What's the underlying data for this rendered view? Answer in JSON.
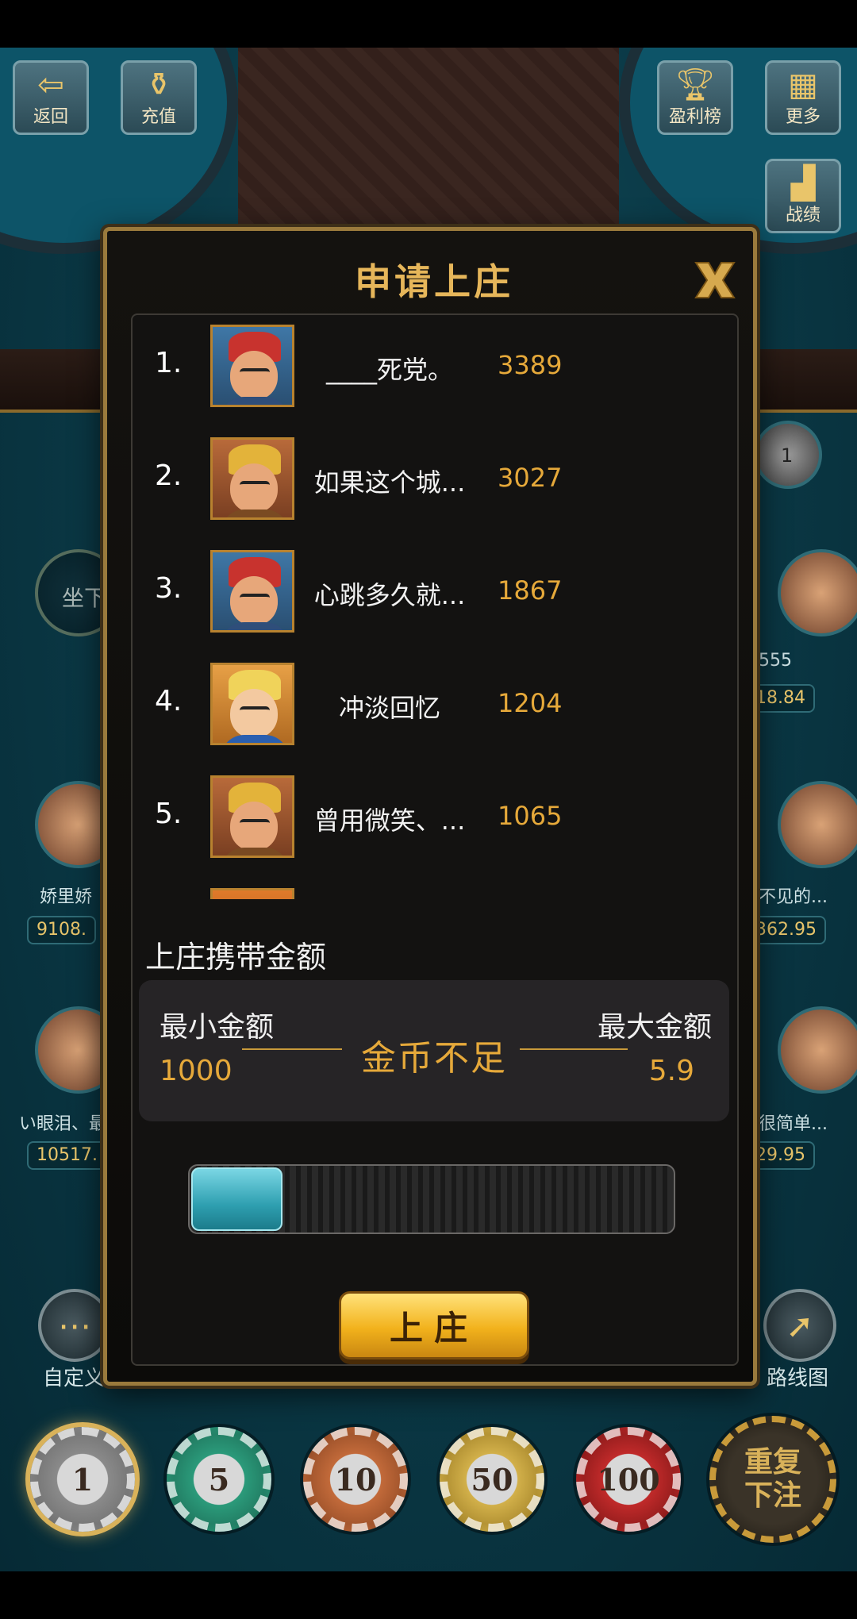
{
  "top_buttons": {
    "back": {
      "label": "返回",
      "icon": "exit-icon"
    },
    "recharge": {
      "label": "充值",
      "icon": "money-bag-icon"
    },
    "leaderboard": {
      "label": "盈利榜",
      "icon": "trophy-icon"
    },
    "more": {
      "label": "更多",
      "icon": "grid-icon"
    },
    "stats": {
      "label": "战绩",
      "icon": "bar-chart-icon"
    }
  },
  "table": {
    "sit_down_label": "坐下",
    "left_seats": [
      {
        "name": "娇里娇",
        "value": "9108."
      },
      {
        "name": "い眼泪、最",
        "value": "10517."
      }
    ],
    "right_seats": [
      {
        "name": "555",
        "value": "18.84"
      },
      {
        "name": "不见的...",
        "value": "362.95"
      },
      {
        "name": "很简单...",
        "value": "29.95"
      }
    ],
    "custom_label": "自定义",
    "route_label": "路线图",
    "chips": [
      "1",
      "5",
      "10",
      "50",
      "100"
    ],
    "repeat_bet": "重复\n下注",
    "selected_chip": "1"
  },
  "dialog": {
    "title": "申请上庄",
    "close_icon": "close-icon",
    "rows": [
      {
        "rank": "1.",
        "name": "____死党。",
        "score": "3389",
        "avatar": "red-bandana-man"
      },
      {
        "rank": "2.",
        "name": "如果这个城...",
        "score": "3027",
        "avatar": "blonde-earring-man"
      },
      {
        "rank": "3.",
        "name": "心跳多久就...",
        "score": "1867",
        "avatar": "red-bandana-man"
      },
      {
        "rank": "4.",
        "name": "冲淡回忆",
        "score": "1204",
        "avatar": "blonde-girl"
      },
      {
        "rank": "5.",
        "name": "曾用微笑、...",
        "score": "1065",
        "avatar": "blonde-earring-man"
      }
    ],
    "carry_label": "上庄携带金额",
    "min_label": "最小金额",
    "max_label": "最大金额",
    "min_value": "1000",
    "max_value": "5.9",
    "status": "金币不足",
    "slider_fraction": 0.19,
    "confirm_label": "上庄",
    "colors": {
      "gold": "#e6b65a",
      "score": "#e6a93a",
      "slider": "#2e9fb0"
    }
  }
}
